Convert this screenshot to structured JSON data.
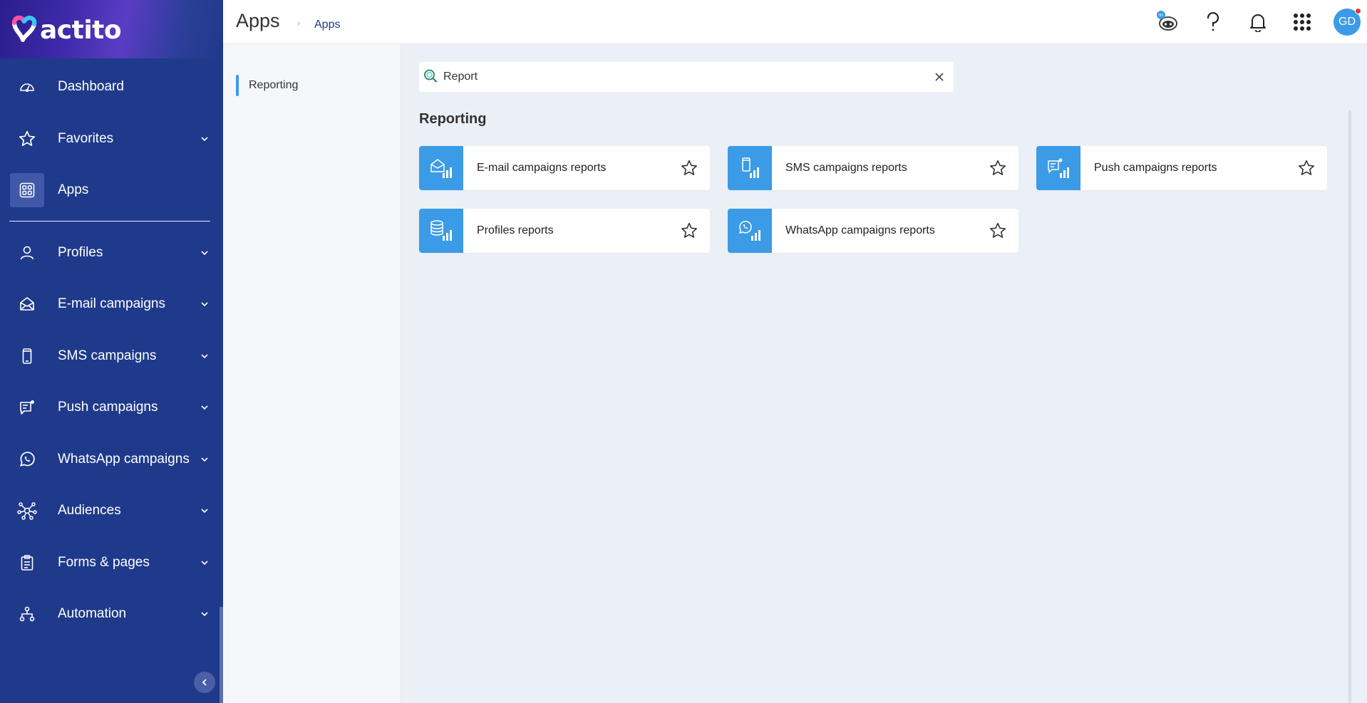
{
  "sidebar": {
    "logo_text": "actito",
    "items": [
      {
        "label": "Dashboard",
        "icon": "dashboard-icon",
        "expandable": false
      },
      {
        "label": "Favorites",
        "icon": "star-icon",
        "expandable": true
      },
      {
        "label": "Apps",
        "icon": "apps-grid-icon",
        "expandable": false,
        "active": true
      },
      {
        "label": "Profiles",
        "icon": "user-icon",
        "expandable": true
      },
      {
        "label": "E-mail campaigns",
        "icon": "envelope-icon",
        "expandable": true
      },
      {
        "label": "SMS campaigns",
        "icon": "phone-icon",
        "expandable": true
      },
      {
        "label": "Push campaigns",
        "icon": "push-message-icon",
        "expandable": true
      },
      {
        "label": "WhatsApp campaigns",
        "icon": "whatsapp-icon",
        "expandable": true
      },
      {
        "label": "Audiences",
        "icon": "network-icon",
        "expandable": true
      },
      {
        "label": "Forms & pages",
        "icon": "clipboard-icon",
        "expandable": true
      },
      {
        "label": "Automation",
        "icon": "automation-icon",
        "expandable": true
      }
    ]
  },
  "header": {
    "title": "Apps",
    "breadcrumb": "Apps",
    "avatar_initials": "GD"
  },
  "categories": [
    {
      "label": "Reporting"
    }
  ],
  "search": {
    "value": "Report",
    "placeholder": ""
  },
  "section": {
    "title": "Reporting",
    "apps": [
      {
        "label": "E-mail campaigns reports",
        "icon": "email-report-icon"
      },
      {
        "label": "SMS campaigns reports",
        "icon": "sms-report-icon"
      },
      {
        "label": "Push campaigns reports",
        "icon": "push-report-icon"
      },
      {
        "label": "Profiles reports",
        "icon": "profiles-report-icon"
      },
      {
        "label": "WhatsApp campaigns reports",
        "icon": "whatsapp-report-icon"
      }
    ]
  },
  "colors": {
    "sidebar": "#1f3a8a",
    "accent": "#3b9be6",
    "background": "#ebf0f6"
  }
}
